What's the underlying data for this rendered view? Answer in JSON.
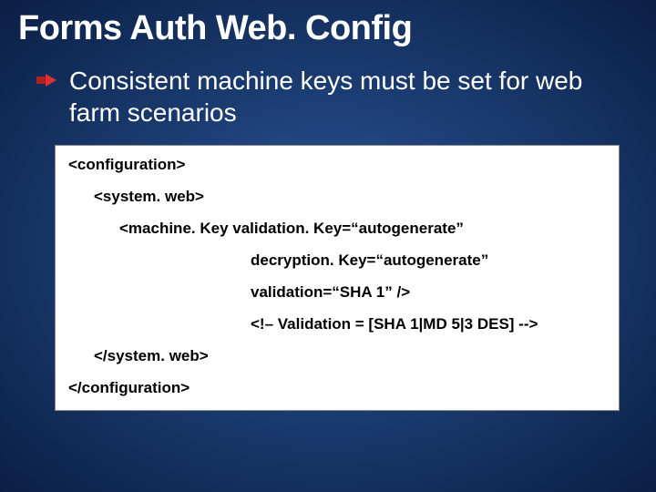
{
  "title": "Forms Auth Web. Config",
  "bullet": "Consistent machine keys must be set for web farm scenarios",
  "code": {
    "l1": "<configuration>",
    "l2": "<system. web>",
    "l3": "<machine. Key validation. Key=“autogenerate”",
    "l4": "decryption. Key=“autogenerate”",
    "l5": "validation=“SHA 1” />",
    "l6": "<!– Validation = [SHA 1|MD 5|3 DES] -->",
    "l7": "</system. web>",
    "l8": "</configuration>"
  }
}
